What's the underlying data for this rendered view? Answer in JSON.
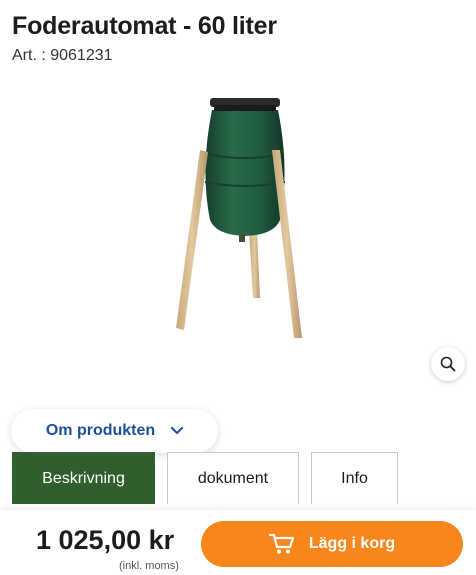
{
  "product": {
    "title": "Foderautomat - 60 liter",
    "article": "Art. : 9061231"
  },
  "image": {
    "icon": "feeder-barrel-on-tripod"
  },
  "zoom": {
    "icon": "magnifier-icon"
  },
  "about": {
    "label": "Om produkten",
    "icon": "chevron-down-icon"
  },
  "tabs": [
    {
      "label": "Beskrivning",
      "active": true
    },
    {
      "label": "dokument",
      "active": false
    },
    {
      "label": "Info",
      "active": false
    }
  ],
  "purchase": {
    "price": "1 025,00 kr",
    "vat_note": "(inkl. moms)",
    "button_label": "Lägg i korg",
    "button_icon": "cart-icon"
  },
  "colors": {
    "accent_orange": "#f7861d",
    "tab_active_green": "#2f5f2a",
    "link_blue": "#1f4f9c",
    "barrel_green": "#1f5a3f"
  }
}
